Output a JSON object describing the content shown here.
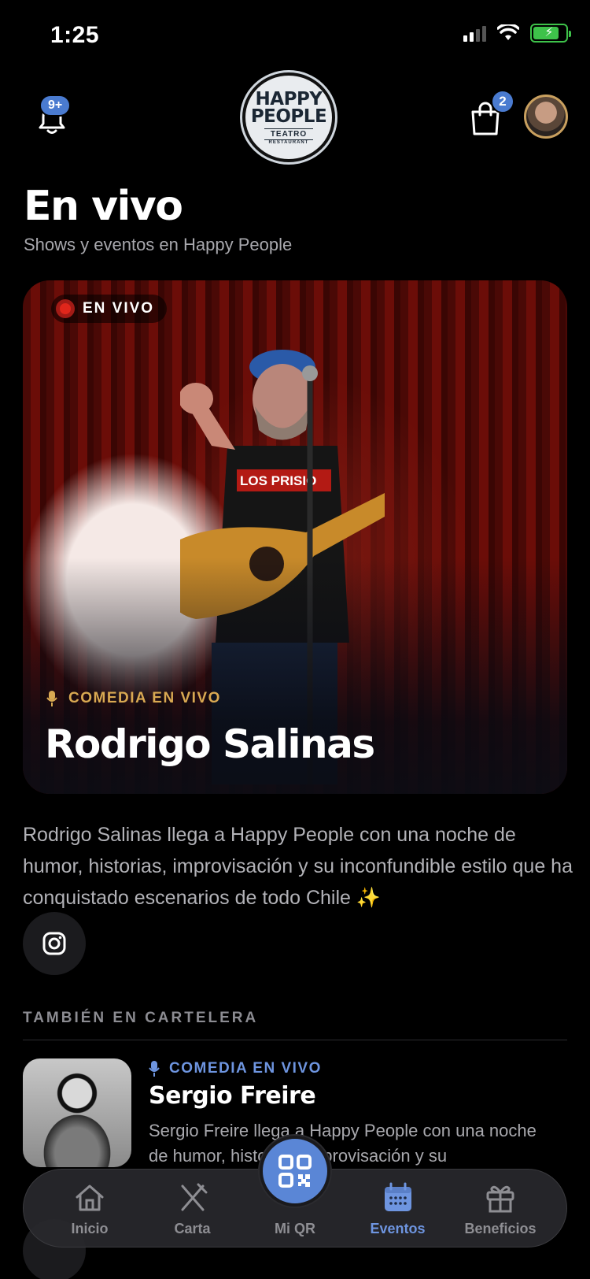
{
  "status_bar": {
    "time": "1:25"
  },
  "header": {
    "notifications_badge": "9+",
    "cart_badge": "2",
    "logo": {
      "line1": "HAPPY",
      "line2": "PEOPLE",
      "line3": "TEATRO",
      "line4": "RESTAURANT"
    }
  },
  "page": {
    "title": "En vivo",
    "subtitle": "Shows y eventos en Happy People"
  },
  "featured": {
    "live_label": "EN VIVO",
    "category": "COMEDIA EN VIVO",
    "name": "Rodrigo Salinas",
    "description": "Rodrigo Salinas llega a Happy People con una noche de humor, historias, improvisación y su inconfundible estilo que ha conquistado escenarios de todo Chile ✨"
  },
  "section": {
    "label": "TAMBIÉN EN CARTELERA"
  },
  "listings": [
    {
      "category": "COMEDIA EN VIVO",
      "name": "Sergio Freire",
      "description": "Sergio Freire llega a Happy People con una noche de humor, historias, improvisación y su"
    }
  ],
  "tabbar": {
    "tabs": [
      {
        "label": "Inicio",
        "icon": "home-icon"
      },
      {
        "label": "Carta",
        "icon": "utensils-icon"
      },
      {
        "label": "Mi QR",
        "icon": "qr-icon"
      },
      {
        "label": "Eventos",
        "icon": "calendar-icon",
        "active": true
      },
      {
        "label": "Beneficios",
        "icon": "gift-icon"
      }
    ]
  },
  "colors": {
    "accent": "#5a86d6",
    "live_red": "#e0261b",
    "gold": "#d9a952"
  }
}
